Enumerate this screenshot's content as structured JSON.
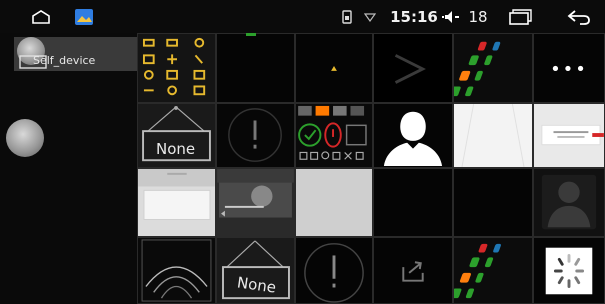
{
  "status_bar": {
    "time": "15:16",
    "volume": "18",
    "icons": [
      "home-icon",
      "gallery-icon",
      "sim-icon",
      "wifi-icon",
      "volume-icon",
      "recent-apps-icon",
      "back-icon"
    ]
  },
  "sidebar": {
    "device_label": "Self_device"
  },
  "grid": {
    "more_label": "•••",
    "none_label_1": "None",
    "none_label_2": "None",
    "shape_selector_icons": [
      "circle-check-icon",
      "circle-cancel-icon",
      "square-alert-icon"
    ]
  },
  "colors": {
    "accent_green": "#2ca02c",
    "accent_orange": "#ff7a00",
    "accent_red": "#d62728",
    "accent_blue": "#1f77b4"
  }
}
